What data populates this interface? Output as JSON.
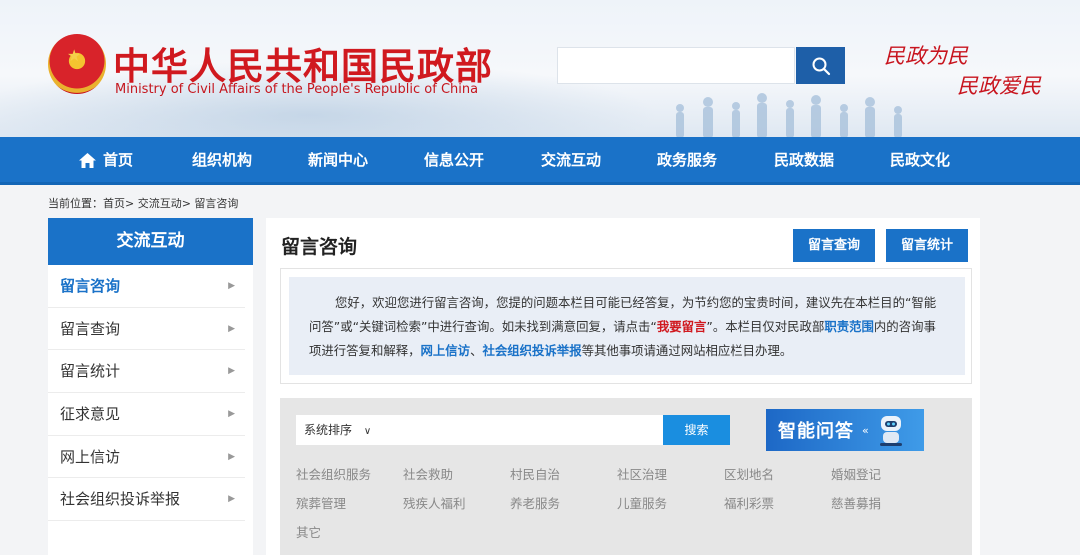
{
  "header": {
    "site_title_cn": "中华人民共和国民政部",
    "site_title_en": "Ministry of Civil Affairs of the People's Republic of China",
    "slogan_line1": "民政为民",
    "slogan_line2": "民政爱民",
    "search_placeholder": ""
  },
  "nav": {
    "items": [
      "首页",
      "组织机构",
      "新闻中心",
      "信息公开",
      "交流互动",
      "政务服务",
      "民政数据",
      "民政文化"
    ]
  },
  "breadcrumb": "当前位置：首页> 交流互动> 留言咨询",
  "sidebar": {
    "title": "交流互动",
    "items": [
      {
        "label": "留言咨询",
        "active": true
      },
      {
        "label": "留言查询",
        "active": false
      },
      {
        "label": "留言统计",
        "active": false
      },
      {
        "label": "征求意见",
        "active": false
      },
      {
        "label": "网上信访",
        "active": false
      },
      {
        "label": "社会组织投诉举报",
        "active": false
      }
    ]
  },
  "main": {
    "title": "留言咨询",
    "btn_query": "留言查询",
    "btn_stats": "留言统计",
    "notice": {
      "p1": "您好，欢迎您进行留言咨询，您提的问题本栏目可能已经答复，为节约您的宝贵时间，建议先在本栏目的“智能问答”或“关键词检索”中进行查询。如未找到满意回复，请点击“",
      "link_leave": "我要留言",
      "p2": "”。本栏目仅对民政部",
      "link_scope": "职责范围",
      "p3": "内的咨询事项进行答复和解释，",
      "link_visit": "网上信访",
      "sep": "、",
      "link_complaint": "社会组织投诉举报",
      "p4": "等其他事项请通过网站相应栏目办理。"
    },
    "sort_label": "系统排序",
    "search_button": "搜索",
    "ai_banner": "智能问答",
    "categories": [
      "社会组织服务",
      "社会救助",
      "村民自治",
      "社区治理",
      "区划地名",
      "婚姻登记",
      "殡葬管理",
      "残疾人福利",
      "养老服务",
      "儿童服务",
      "福利彩票",
      "慈善募捐",
      "其它"
    ]
  }
}
